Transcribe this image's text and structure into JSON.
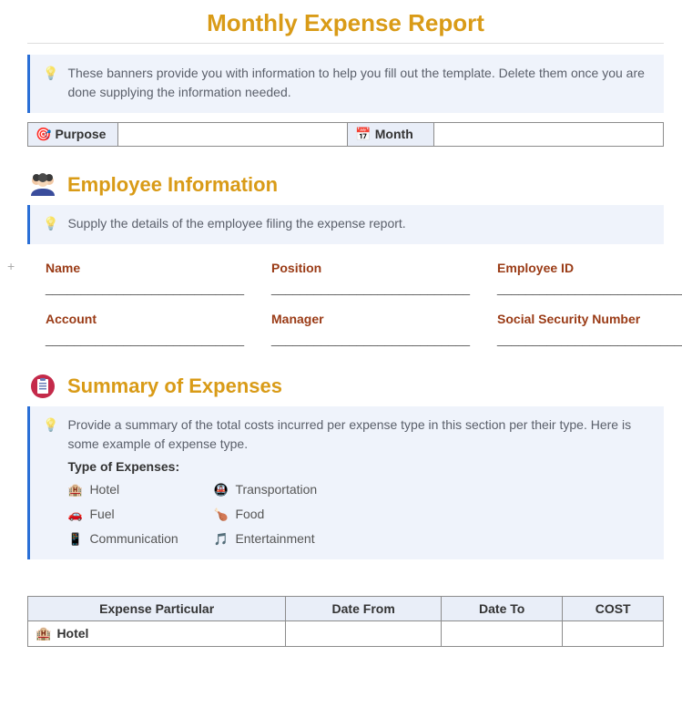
{
  "title": "Monthly Expense Report",
  "banner1": "These banners provide you with information to help you fill out the template. Delete them once you are done supplying the information needed.",
  "purpose_label": "Purpose",
  "month_label": "Month",
  "purpose_value": "",
  "month_value": "",
  "employee": {
    "heading": "Employee Information",
    "banner": "Supply the details of the employee filing the expense report.",
    "fields": [
      {
        "label": "Name",
        "line": "____________________________",
        "name": "name-field"
      },
      {
        "label": "Position",
        "line": "____________________________",
        "name": "position-field"
      },
      {
        "label": "Employee ID",
        "line": "____________________________",
        "name": "employee-id-field"
      },
      {
        "label": "Account",
        "line": "____________________________",
        "name": "account-field"
      },
      {
        "label": "Manager",
        "line": "____________________________",
        "name": "manager-field"
      },
      {
        "label": "Social Security Number",
        "line": "____________________________",
        "name": "ssn-field"
      }
    ]
  },
  "summary": {
    "heading": "Summary of Expenses",
    "banner": "Provide a summary of the total costs incurred per expense type in this section per their type. Here is some example of expense type.",
    "types_title": "Type of Expenses:",
    "types": [
      {
        "icon": "🏨",
        "label": "Hotel"
      },
      {
        "icon": "🚇",
        "label": "Transportation"
      },
      {
        "icon": "🚗",
        "label": "Fuel"
      },
      {
        "icon": "🍗",
        "label": "Food"
      },
      {
        "icon": "📱",
        "label": "Communication"
      },
      {
        "icon": "🎵",
        "label": "Entertainment"
      }
    ]
  },
  "expense_table": {
    "headers": [
      "Expense Particular",
      "Date From",
      "Date To",
      "COST"
    ],
    "rows": [
      {
        "icon": "🏨",
        "label": "Hotel",
        "from": "",
        "to": "",
        "cost": ""
      }
    ]
  }
}
